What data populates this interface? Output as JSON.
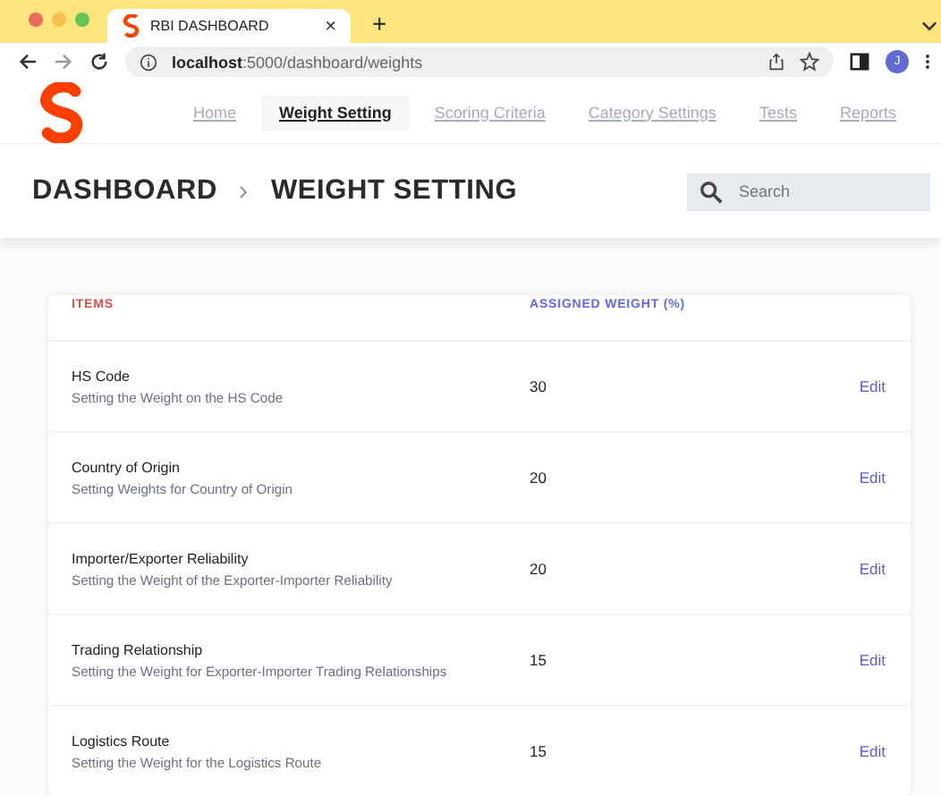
{
  "browser": {
    "tab_title": "RBI DASHBOARD",
    "tab_close": "×",
    "new_tab": "+",
    "url_host": "localhost",
    "url_path": ":5000/dashboard/weights",
    "avatar": "J"
  },
  "nav": [
    {
      "label": "Home",
      "selected": false
    },
    {
      "label": "Weight Setting",
      "selected": true
    },
    {
      "label": "Scoring Criteria",
      "selected": false
    },
    {
      "label": "Category Settings",
      "selected": false
    },
    {
      "label": "Tests",
      "selected": false
    },
    {
      "label": "Reports",
      "selected": false
    }
  ],
  "breadcrumb": [
    "DASHBOARD",
    "WEIGHT SETTING"
  ],
  "search": {
    "placeholder": "Search"
  },
  "table": {
    "columns": [
      "ITEMS",
      "ASSIGNED WEIGHT (%)"
    ],
    "rows": [
      {
        "name": "HS Code",
        "description": "Setting the Weight on the HS Code",
        "weight": "30",
        "action": "Edit"
      },
      {
        "name": "Country of Origin",
        "description": "Setting Weights for Country of Origin",
        "weight": "20",
        "action": "Edit"
      },
      {
        "name": "Importer/Exporter Reliability",
        "description": "Setting the Weight of the Exporter-Importer Reliability",
        "weight": "20",
        "action": "Edit"
      },
      {
        "name": "Trading Relationship",
        "description": "Setting the Weight for Exporter-Importer Trading Relationships",
        "weight": "15",
        "action": "Edit"
      },
      {
        "name": "Logistics Route",
        "description": "Setting the Weight for the Logistics Route",
        "weight": "15",
        "action": "Edit"
      }
    ]
  }
}
